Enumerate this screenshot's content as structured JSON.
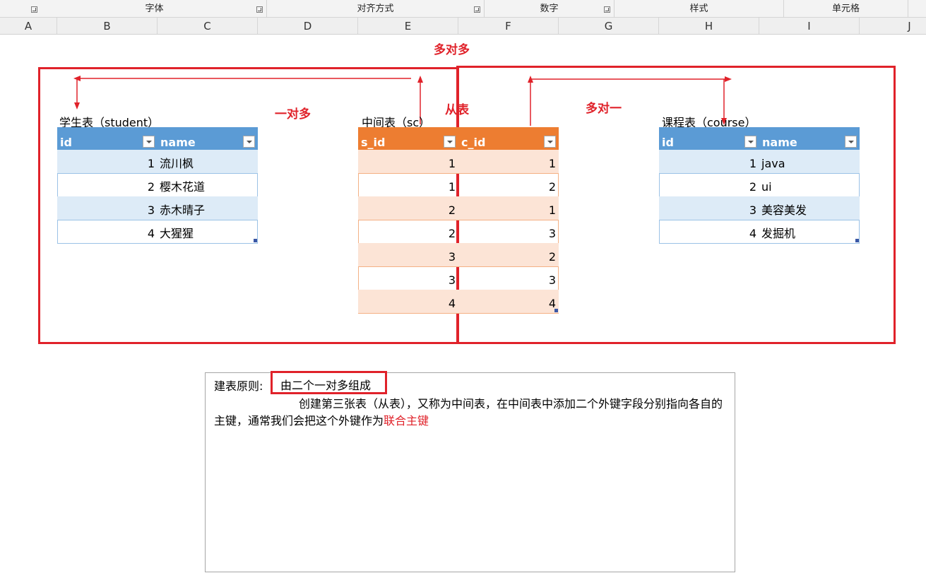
{
  "ribbon": {
    "groups": [
      {
        "label": "字体"
      },
      {
        "label": "对齐方式"
      },
      {
        "label": "数字"
      },
      {
        "label": "样式"
      },
      {
        "label": "单元格"
      }
    ]
  },
  "columns": [
    "A",
    "B",
    "C",
    "D",
    "E",
    "F",
    "G",
    "H",
    "I",
    "J"
  ],
  "annotations": {
    "many_to_many": "多对多",
    "one_to_many": "一对多",
    "slave_table": "从表",
    "many_to_one": "多对一"
  },
  "student": {
    "title": "学生表（student）",
    "headers": [
      "id",
      "name"
    ],
    "rows": [
      {
        "id": "1",
        "name": "流川枫"
      },
      {
        "id": "2",
        "name": "樱木花道"
      },
      {
        "id": "3",
        "name": "赤木晴子"
      },
      {
        "id": "4",
        "name": "大猩猩"
      }
    ]
  },
  "sc": {
    "title": "中间表（sc）",
    "headers": [
      "s_id",
      "c_id"
    ],
    "rows": [
      {
        "s_id": "1",
        "c_id": "1"
      },
      {
        "s_id": "1",
        "c_id": "2"
      },
      {
        "s_id": "2",
        "c_id": "1"
      },
      {
        "s_id": "2",
        "c_id": "3"
      },
      {
        "s_id": "3",
        "c_id": "2"
      },
      {
        "s_id": "3",
        "c_id": "3"
      },
      {
        "s_id": "4",
        "c_id": "4"
      }
    ]
  },
  "course": {
    "title": "课程表（course）",
    "headers": [
      "id",
      "name"
    ],
    "rows": [
      {
        "id": "1",
        "name": "java"
      },
      {
        "id": "2",
        "name": "ui"
      },
      {
        "id": "3",
        "name": "美容美发"
      },
      {
        "id": "4",
        "name": "发掘机"
      }
    ]
  },
  "note": {
    "label": "建表原则:",
    "principle": "由二个一对多组成",
    "body": "创建第三张表（从表），又称为中间表，在中间表中添加二个外键字段分别指向各自的主键，通常我们会把这个外键作为",
    "highlight": "联合主键"
  },
  "colors": {
    "accent_red": "#e0222a",
    "header_blue": "#5b9bd5",
    "band_blue": "#ddebf7",
    "header_orange": "#ed7d31",
    "band_orange": "#fce4d6"
  }
}
